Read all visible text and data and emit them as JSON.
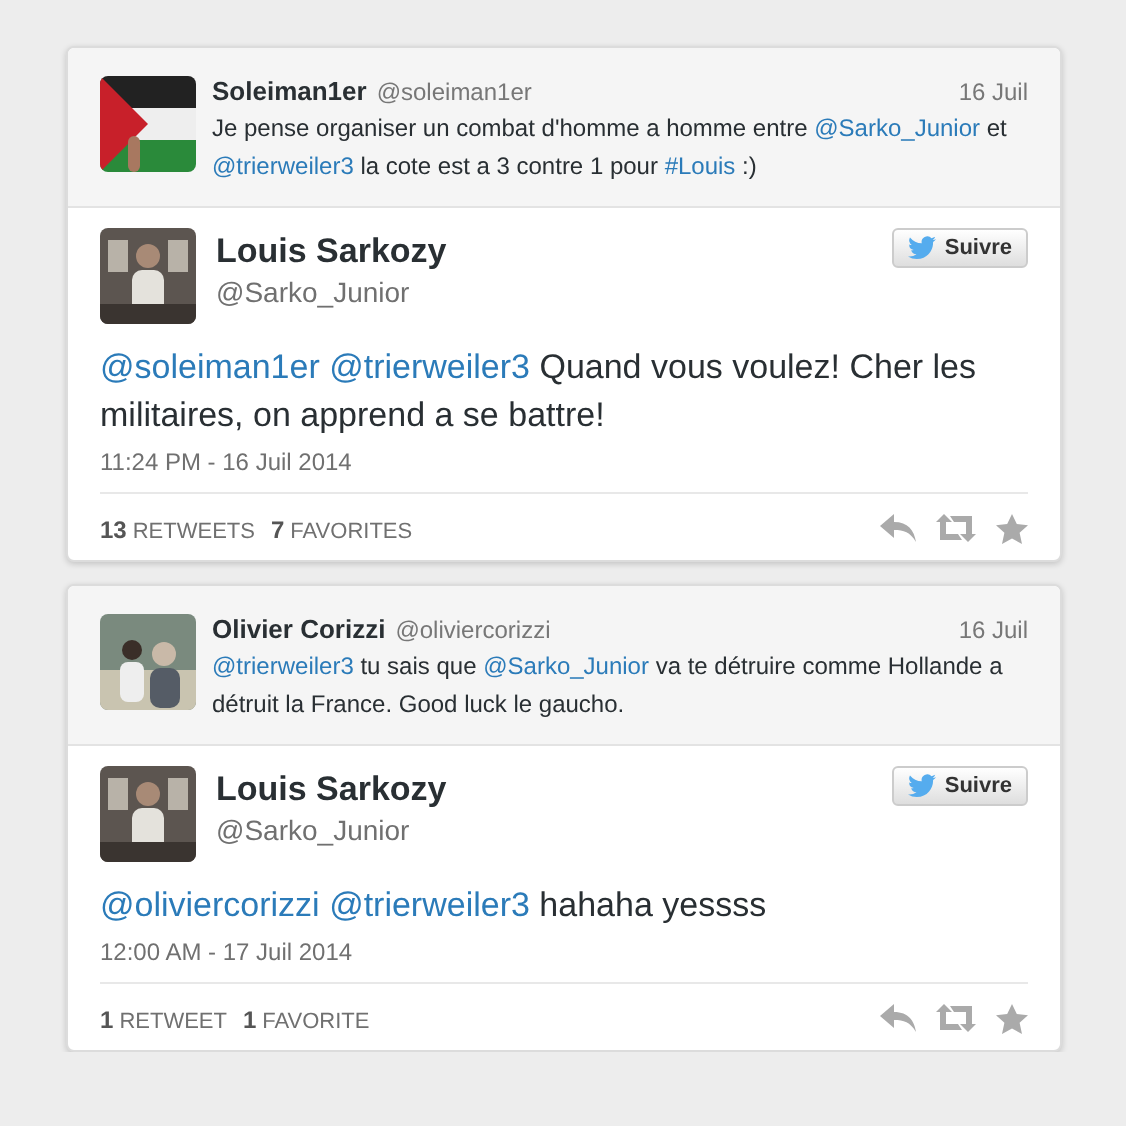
{
  "tweets": [
    {
      "reply_to": {
        "name": "Soleiman1er",
        "handle": "@soleiman1er",
        "date": "16 Juil",
        "text": [
          {
            "kind": "plain",
            "text": "Je pense organiser un combat d'homme a homme entre "
          },
          {
            "kind": "link",
            "text": "@Sarko_Junior"
          },
          {
            "kind": "plain",
            "text": " et "
          },
          {
            "kind": "link",
            "text": "@trierweiler3"
          },
          {
            "kind": "plain",
            "text": " la cote est a 3 contre 1 pour "
          },
          {
            "kind": "link",
            "text": "#Louis"
          },
          {
            "kind": "plain",
            "text": " :)"
          }
        ]
      },
      "author": {
        "name": "Louis Sarkozy",
        "handle": "@Sarko_Junior"
      },
      "follow_label": "Suivre",
      "text": [
        {
          "kind": "link",
          "text": "@soleiman1er"
        },
        {
          "kind": "link",
          "text": "@trierweiler3"
        },
        {
          "kind": "plain",
          "text": " Quand vous voulez! Cher les militaires, on apprend a se battre!"
        }
      ],
      "timestamp": "11:24 PM - 16 Juil 2014",
      "stats": [
        {
          "count": "13",
          "label": "RETWEETS"
        },
        {
          "count": "7",
          "label": "FAVORITES"
        }
      ]
    },
    {
      "reply_to": {
        "name": "Olivier Corizzi",
        "handle": "@oliviercorizzi",
        "date": "16 Juil",
        "text": [
          {
            "kind": "link",
            "text": "@trierweiler3"
          },
          {
            "kind": "plain",
            "text": " tu sais que "
          },
          {
            "kind": "link",
            "text": "@Sarko_Junior"
          },
          {
            "kind": "plain",
            "text": " va te détruire comme Hollande a détruit la France. Good luck le gaucho."
          }
        ]
      },
      "author": {
        "name": "Louis Sarkozy",
        "handle": "@Sarko_Junior"
      },
      "follow_label": "Suivre",
      "text": [
        {
          "kind": "link",
          "text": "@oliviercorizzi"
        },
        {
          "kind": "link",
          "text": "@trierweiler3"
        },
        {
          "kind": "plain",
          "text": " hahaha yessss"
        }
      ],
      "timestamp": "12:00 AM - 17 Juil 2014",
      "stats": [
        {
          "count": "1",
          "label": "RETWEET"
        },
        {
          "count": "1",
          "label": "FAVORITE"
        }
      ]
    }
  ]
}
